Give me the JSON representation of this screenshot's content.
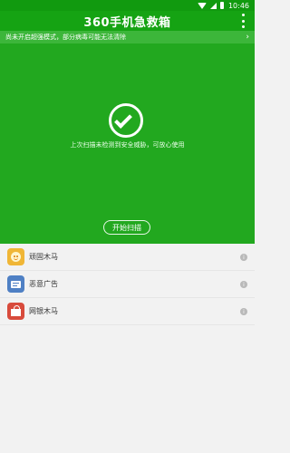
{
  "status_bar": {
    "time": "10:46"
  },
  "header": {
    "title": "360手机急救箱"
  },
  "notice": {
    "text": "尚未开启超强模式，部分病毒可能无法清除"
  },
  "hero": {
    "message": "上次扫描未检测到安全威胁，可放心使用",
    "button_label": "开始扫描"
  },
  "list": {
    "items": [
      {
        "label": "顽固木马",
        "icon": "trojan-icon"
      },
      {
        "label": "恶意广告",
        "icon": "ad-icon"
      },
      {
        "label": "网银木马",
        "icon": "bank-trojan-icon"
      }
    ]
  },
  "colors": {
    "primary_green": "#22a81f",
    "header_green": "#15a313",
    "status_green": "#119a0f",
    "notice_green": "#3cb63a"
  }
}
